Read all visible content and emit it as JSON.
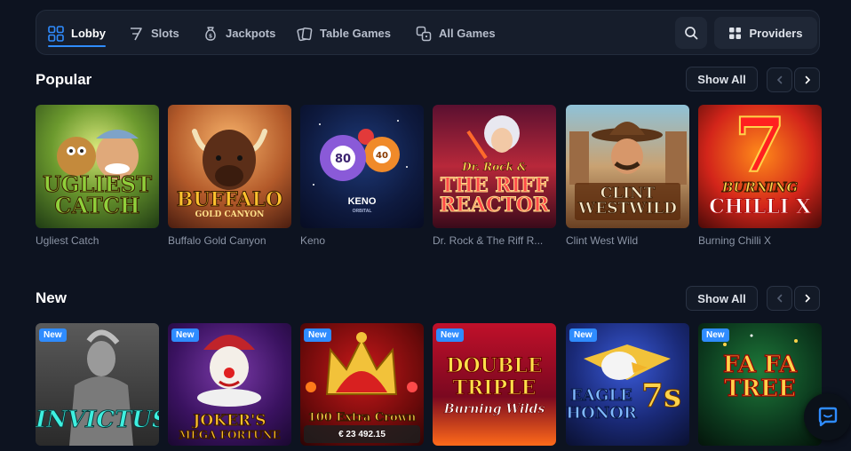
{
  "nav": {
    "tabs": [
      {
        "label": "Lobby",
        "icon": "grid-icon"
      },
      {
        "label": "Slots",
        "icon": "slot-seven-icon"
      },
      {
        "label": "Jackpots",
        "icon": "money-bag-icon"
      },
      {
        "label": "Table Games",
        "icon": "cards-icon"
      },
      {
        "label": "All Games",
        "icon": "dice-icon"
      }
    ],
    "active_tab": "Lobby",
    "search_icon": "search-icon",
    "providers_label": "Providers",
    "accent_color": "#2f8cff"
  },
  "popular": {
    "title": "Popular",
    "show_all_label": "Show All",
    "games": [
      {
        "name": "Ugliest Catch",
        "art_text": "UGLIEST CATCH"
      },
      {
        "name": "Buffalo Gold Canyon",
        "art_text": "BUFFALO",
        "art_sub": "GOLD CANYON"
      },
      {
        "name": "Keno",
        "art_text": "KENO",
        "art_sub": "ORBITAL",
        "balls": [
          "80",
          "40"
        ]
      },
      {
        "name": "Dr. Rock & The Riff R...",
        "art_text": "THE RIFF REACTOR",
        "art_top": "Dr. Rock &"
      },
      {
        "name": "Clint West Wild",
        "art_text": "CLINT WESTWILD"
      },
      {
        "name": "Burning Chilli X",
        "art_text": "BURNING",
        "art_sub": "CHILLI X",
        "art_big": "7"
      }
    ]
  },
  "new": {
    "title": "New",
    "show_all_label": "Show All",
    "badge_label": "New",
    "games": [
      {
        "art_text": "INVICTUS"
      },
      {
        "art_text": "JOKER'S",
        "art_sub": "MEGA FORTUNE"
      },
      {
        "art_text": "100 Extra Crown",
        "jackpot": "€ 23 492.15"
      },
      {
        "art_text": "DOUBLE TRIPLE",
        "art_sub": "Burning Wilds"
      },
      {
        "art_text": "EAGLE HONOR",
        "art_big": "7s"
      },
      {
        "art_text": "FA FA TREE"
      }
    ]
  },
  "chat_icon": "chat-bubble-icon"
}
